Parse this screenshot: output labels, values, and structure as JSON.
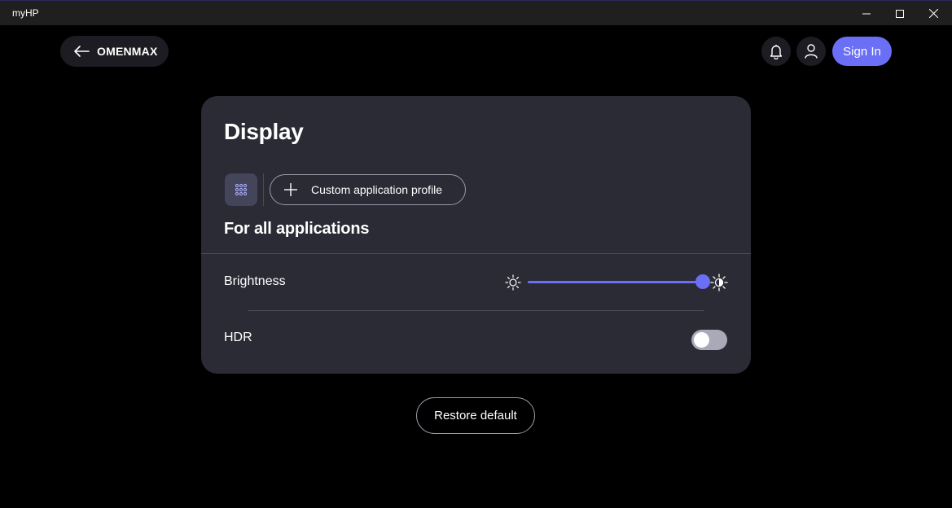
{
  "window": {
    "title": "myHP",
    "controls": [
      "minimize-icon",
      "maximize-icon",
      "close-icon"
    ]
  },
  "header": {
    "back_label": "OMENMAX",
    "back_icon": "arrow-left-icon",
    "notifications_icon": "bell-icon",
    "account_icon": "user-icon",
    "sign_in_label": "Sign In",
    "accent_color": "#6a6ff5"
  },
  "card": {
    "title": "Display",
    "apps_icon": "grid-icon",
    "profile_button_label": "Custom application profile",
    "profile_button_icon": "plus-icon",
    "section_title": "For all applications",
    "brightness": {
      "label": "Brightness",
      "value_fraction": 0.95,
      "low_icon": "sun-low-icon",
      "high_icon": "sun-high-icon"
    },
    "hdr": {
      "label": "HDR",
      "enabled": false
    }
  },
  "footer": {
    "restore_label": "Restore default"
  }
}
